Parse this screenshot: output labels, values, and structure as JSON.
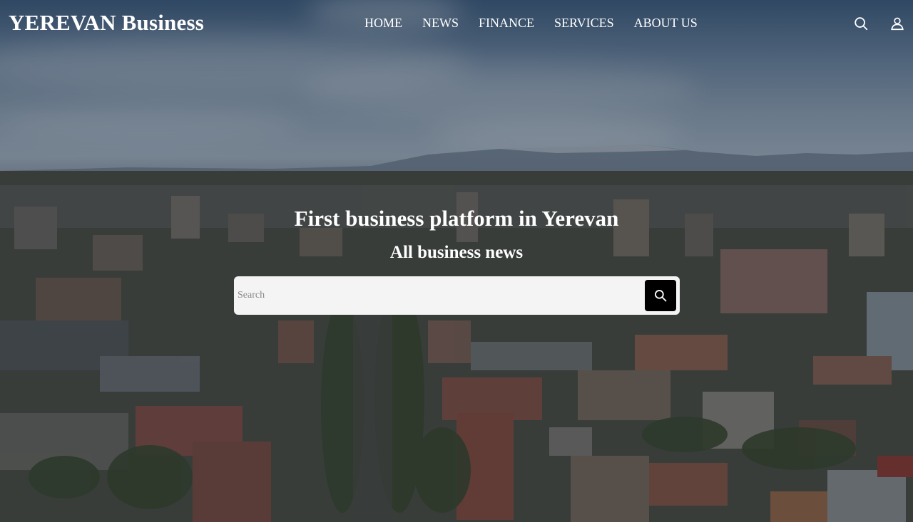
{
  "header": {
    "logo": "YEREVAN Business",
    "nav": [
      "HOME",
      "NEWS",
      "FINANCE",
      "SERVICES",
      "ABOUT US"
    ],
    "icons": {
      "search": "search-icon",
      "user": "user-icon"
    }
  },
  "hero": {
    "headline": "First business platform in Yerevan",
    "subheadline": "All business news",
    "search": {
      "placeholder": "Search",
      "value": ""
    }
  },
  "colors": {
    "text": "#ffffff",
    "search_bg": "#f4f4f4",
    "search_button": "#000000"
  }
}
